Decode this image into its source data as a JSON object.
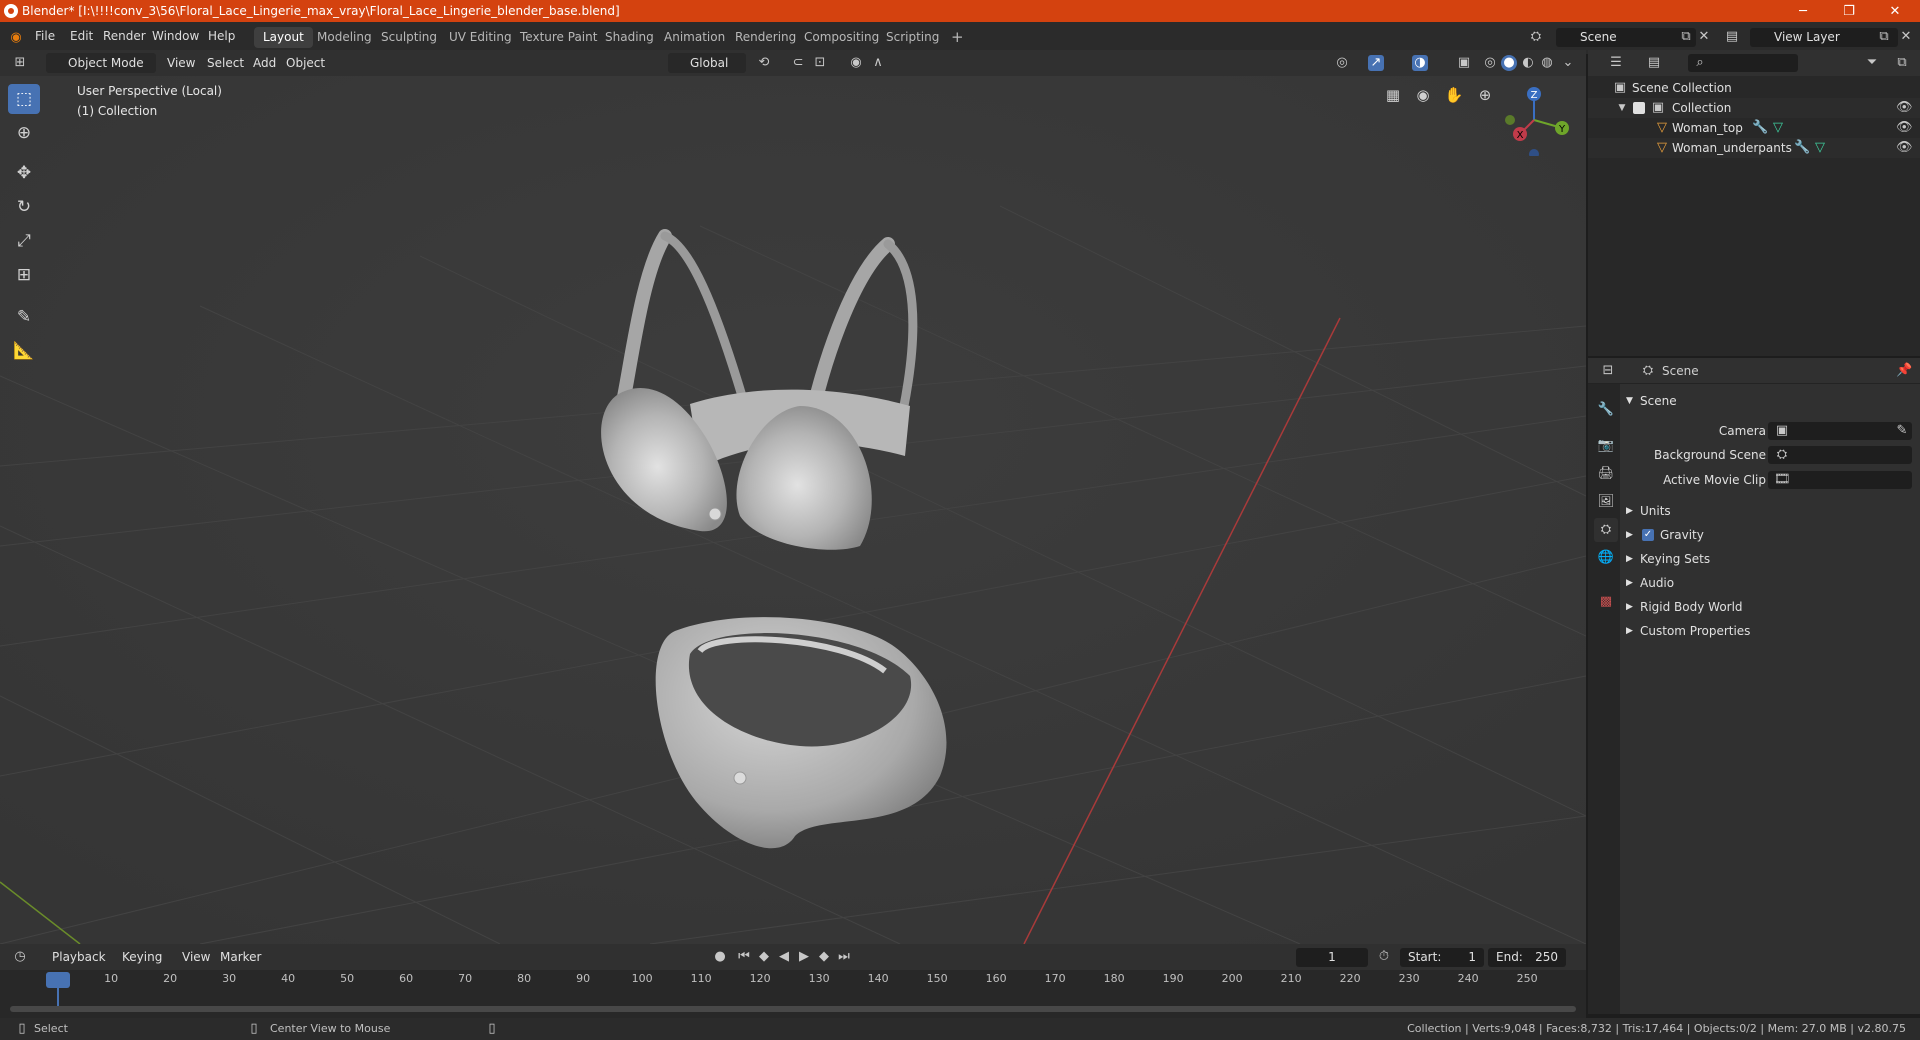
{
  "window": {
    "title": "Blender* [I:\\!!!!conv_3\\56\\Floral_Lace_Lingerie_max_vray\\Floral_Lace_Lingerie_blender_base.blend]",
    "minimize": "─",
    "maximize": "❐",
    "close": "✕"
  },
  "menu": [
    "File",
    "Edit",
    "Render",
    "Window",
    "Help"
  ],
  "workspaces": [
    "Layout",
    "Modeling",
    "Sculpting",
    "UV Editing",
    "Texture Paint",
    "Shading",
    "Animation",
    "Rendering",
    "Compositing",
    "Scripting"
  ],
  "add_workspace": "+",
  "scene_field": "Scene",
  "view_layer_field": "View Layer",
  "viewport_header": {
    "mode": "Object Mode",
    "menus": [
      "View",
      "Select",
      "Add",
      "Object"
    ],
    "transform_orientation": "Global"
  },
  "viewport": {
    "perspective_label": "User Perspective (Local)",
    "collection_label": "(1) Collection",
    "gizmo": {
      "z": "Z",
      "y": "Y",
      "x": "X"
    }
  },
  "outliner": {
    "root": "Scene Collection",
    "collection": "Collection",
    "objects": [
      "Woman_top",
      "Woman_underpants"
    ]
  },
  "properties": {
    "header": "Scene",
    "section": "Scene",
    "fields": {
      "camera": "Camera",
      "background_scene": "Background Scene",
      "active_movie_clip": "Active Movie Clip"
    },
    "panels": [
      "Units",
      "Gravity",
      "Keying Sets",
      "Audio",
      "Rigid Body World",
      "Custom Properties"
    ],
    "gravity_checked": true
  },
  "timeline": {
    "menus": [
      "Playback",
      "Keying",
      "View",
      "Marker"
    ],
    "current_frame": "1",
    "start_label": "Start:",
    "start": "1",
    "end_label": "End:",
    "end": "250",
    "ticks": [
      "1",
      "10",
      "20",
      "30",
      "40",
      "50",
      "60",
      "70",
      "80",
      "90",
      "100",
      "110",
      "120",
      "130",
      "140",
      "150",
      "160",
      "170",
      "180",
      "190",
      "200",
      "210",
      "220",
      "230",
      "240",
      "250"
    ]
  },
  "statusbar": {
    "select": "Select",
    "center_view": "Center View to Mouse",
    "stats": "Collection | Verts:9,048 | Faces:8,732 | Tris:17,464 | Objects:0/2 | Mem: 27.0 MB | v2.80.75"
  },
  "colors": {
    "title_bar": "#d4420f",
    "active_blue": "#4772b3",
    "viewport_bg": "#393939",
    "axis_x_red": "#a83a3a",
    "axis_y_green": "#6a8c2a"
  }
}
